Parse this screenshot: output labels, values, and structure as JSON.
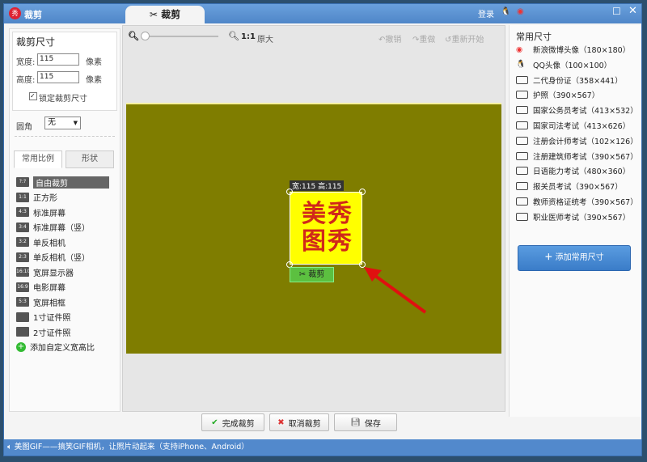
{
  "window": {
    "title": "裁剪",
    "tab": "裁剪",
    "login": "登录"
  },
  "left": {
    "size_title": "裁剪尺寸",
    "width_label": "宽度:",
    "width_value": "115",
    "height_label": "高度:",
    "height_value": "115",
    "unit": "像素",
    "lock_label": "锁定裁剪尺寸",
    "lock_checked": true,
    "corner_label": "圆角",
    "corner_value": "无",
    "tabs": [
      "常用比例",
      "形状"
    ],
    "ratios": [
      {
        "icon": "?:?",
        "label": "自由裁剪",
        "selected": true
      },
      {
        "icon": "1:1",
        "label": "正方形"
      },
      {
        "icon": "4:3",
        "label": "标准屏幕"
      },
      {
        "icon": "3:4",
        "label": "标准屏幕（竖）"
      },
      {
        "icon": "3:2",
        "label": "单反相机"
      },
      {
        "icon": "2:3",
        "label": "单反相机（竖）"
      },
      {
        "icon": "16:10",
        "label": "宽屏显示器"
      },
      {
        "icon": "16:9",
        "label": "电影屏幕"
      },
      {
        "icon": "5:3",
        "label": "宽屏相框"
      },
      {
        "icon": "id",
        "label": "1寸证件照"
      },
      {
        "icon": "id",
        "label": "2寸证件照"
      }
    ],
    "add_ratio": "添加自定义宽高比"
  },
  "toolbar": {
    "zoom_label": "1:1",
    "original": "原大",
    "undo": "撤销",
    "redo": "重做",
    "restart": "重新开始",
    "zoom_level": 0
  },
  "canvas": {
    "crop_size": "宽:115 高:115",
    "image_text": [
      "美",
      "秀",
      "图",
      "秀"
    ],
    "crop_button": "裁剪"
  },
  "right": {
    "title": "常用尺寸",
    "presets": [
      {
        "icon": "weibo",
        "label": "新浪微博头像（180×180）"
      },
      {
        "icon": "qq",
        "label": "QQ头像（100×100）"
      },
      {
        "icon": "id",
        "label": "二代身份证（358×441）"
      },
      {
        "icon": "id",
        "label": "护照（390×567）"
      },
      {
        "icon": "id",
        "label": "国家公务员考试（413×532）"
      },
      {
        "icon": "id",
        "label": "国家司法考试（413×626）"
      },
      {
        "icon": "id",
        "label": "注册会计师考试（102×126）"
      },
      {
        "icon": "id",
        "label": "注册建筑师考试（390×567）"
      },
      {
        "icon": "id",
        "label": "日语能力考试（480×360）"
      },
      {
        "icon": "id",
        "label": "报关员考试（390×567）"
      },
      {
        "icon": "id",
        "label": "教师资格证统考（390×567）"
      },
      {
        "icon": "id",
        "label": "职业医师考试（390×567）"
      }
    ],
    "add_button": "添加常用尺寸"
  },
  "bottom": {
    "done": "完成裁剪",
    "cancel": "取消裁剪",
    "save": "保存"
  },
  "status": "美图GIF——搞笑GIF相机，让照片动起来（支持iPhone、Android）"
}
